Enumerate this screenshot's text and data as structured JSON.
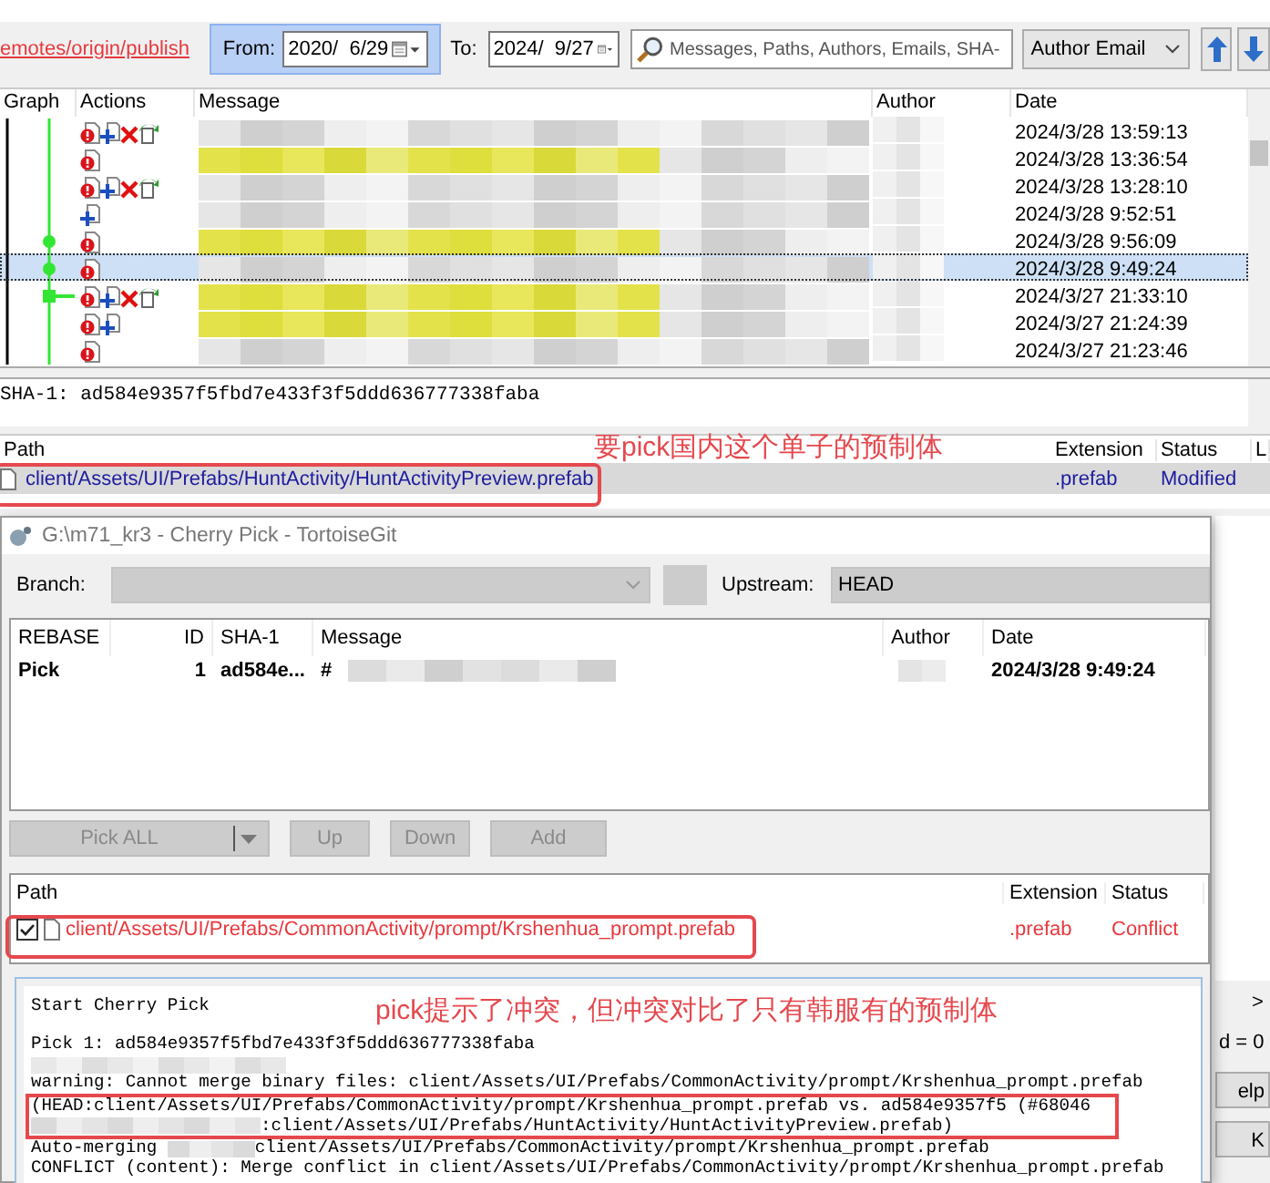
{
  "log_window": {
    "toolbar": {
      "branch_link": "emotes/origin/publish",
      "from_label": "From:",
      "from_date": "2020/  6/29",
      "to_label": "To:",
      "to_date": "2024/  9/27",
      "search": {
        "placeholder": "Messages, Paths, Authors, Emails, SHA-"
      },
      "filter": "Author Email"
    },
    "log": {
      "columns": [
        "Graph",
        "Actions",
        "Message",
        "Author",
        "Date"
      ],
      "rows": [
        {
          "actions": [
            {
              "kind": "modified"
            },
            {
              "kind": "added"
            },
            {
              "kind": "deleted"
            },
            {
              "kind": "renamed"
            }
          ],
          "tagged": false,
          "date": "2024/3/28 13:59:13",
          "selected": false
        },
        {
          "actions": [
            {
              "kind": "modified"
            }
          ],
          "tagged": true,
          "date": "2024/3/28 13:36:54",
          "selected": false
        },
        {
          "actions": [
            {
              "kind": "modified"
            },
            {
              "kind": "added"
            },
            {
              "kind": "deleted"
            },
            {
              "kind": "renamed"
            }
          ],
          "tagged": false,
          "date": "2024/3/28 13:28:10",
          "selected": false
        },
        {
          "actions": [
            {
              "kind": "added"
            }
          ],
          "tagged": false,
          "date": "2024/3/28 9:52:51",
          "selected": false
        },
        {
          "node": {
            "kind": "dot"
          },
          "actions": [
            {
              "kind": "modified"
            }
          ],
          "tagged": true,
          "date": "2024/3/28 9:56:09",
          "selected": false
        },
        {
          "node": {
            "kind": "dot"
          },
          "actions": [
            {
              "kind": "modified"
            }
          ],
          "tagged": false,
          "date": "2024/3/28 9:49:24",
          "selected": true
        },
        {
          "node": {
            "kind": "merge"
          },
          "actions": [
            {
              "kind": "modified"
            },
            {
              "kind": "added"
            },
            {
              "kind": "deleted"
            },
            {
              "kind": "renamed"
            }
          ],
          "tagged": true,
          "date": "2024/3/27 21:33:10",
          "selected": false
        },
        {
          "actions": [
            {
              "kind": "modified"
            },
            {
              "kind": "added"
            }
          ],
          "tagged": true,
          "date": "2024/3/27 21:24:39",
          "selected": false
        },
        {
          "actions": [
            {
              "kind": "modified"
            }
          ],
          "tagged": false,
          "date": "2024/3/27 21:23:46",
          "selected": false
        }
      ]
    },
    "sha": "SHA-1: ad584e9357f5fbd7e433f3f5ddd636777338faba",
    "files": {
      "columns": [
        "Path",
        "Extension",
        "Status",
        "L"
      ],
      "rows": [
        {
          "path": "client/Assets/UI/Prefabs/HuntActivity/HuntActivityPreview.prefab",
          "extension": ".prefab",
          "status": "Modified"
        }
      ]
    },
    "annotation": "要pick国内这个单子的预制体",
    "behind": {
      "scroll_arrow": ">",
      "fragment": "d = 0",
      "buttons": [
        "elp",
        "K"
      ]
    }
  },
  "cherry_pick": {
    "title": "G:\\m71_kr3 - Cherry Pick - TortoiseGit",
    "branch_label": "Branch:",
    "upstream_label": "Upstream:",
    "upstream": "HEAD",
    "table": {
      "columns": [
        "REBASE",
        "ID",
        "SHA-1",
        "Message",
        "Author",
        "Date"
      ],
      "rows": [
        {
          "rebase": "Pick",
          "id": "1",
          "sha": "ad584e...",
          "message": "#",
          "date": "2024/3/28 9:49:24"
        }
      ]
    },
    "buttons": [
      {
        "label": "Pick ALL",
        "dropdown": true,
        "disabled": true
      },
      {
        "label": "Up",
        "dropdown": false,
        "disabled": true
      },
      {
        "label": "Down",
        "dropdown": false,
        "disabled": true
      },
      {
        "label": "Add",
        "dropdown": false,
        "disabled": true
      }
    ],
    "files": {
      "columns": [
        "Path",
        "Extension",
        "Status"
      ],
      "rows": [
        {
          "checked": true,
          "path": "client/Assets/UI/Prefabs/CommonActivity/prompt/Krshenhua_prompt.prefab",
          "extension": ".prefab",
          "status": "Conflict"
        }
      ]
    },
    "progress": {
      "annotation": "pick提示了冲突，但冲突对比了只有韩服有的预制体",
      "lines": [
        {
          "kind": "text",
          "text": "Start Cherry Pick"
        },
        {
          "kind": "blank"
        },
        {
          "kind": "text",
          "text": "Pick 1: ad584e9357f5fbd7e433f3f5ddd636777338faba"
        },
        {
          "kind": "blurred"
        },
        {
          "kind": "text",
          "text": "warning: Cannot merge binary files: client/Assets/UI/Prefabs/CommonActivity/prompt/Krshenhua_prompt.prefab"
        },
        {
          "kind": "highlight",
          "lines": [
            {
              "kind": "text",
              "text": "(HEAD:client/Assets/UI/Prefabs/CommonActivity/prompt/Krshenhua_prompt.prefab vs. ad584e9357f5 (#68046"
            },
            {
              "kind": "blurred_prefix",
              "text": ":client/Assets/UI/Prefabs/HuntActivity/HuntActivityPreview.prefab)"
            }
          ]
        },
        {
          "kind": "blurred_prefix",
          "text": "client/Assets/UI/Prefabs/CommonActivity/prompt/Krshenhua_prompt.prefab",
          "prefix": "Auto-merging "
        },
        {
          "kind": "text",
          "text": "CONFLICT (content): Merge conflict in client/Assets/UI/Prefabs/CommonActivity/prompt/Krshenhua_prompt.prefab"
        }
      ]
    }
  }
}
